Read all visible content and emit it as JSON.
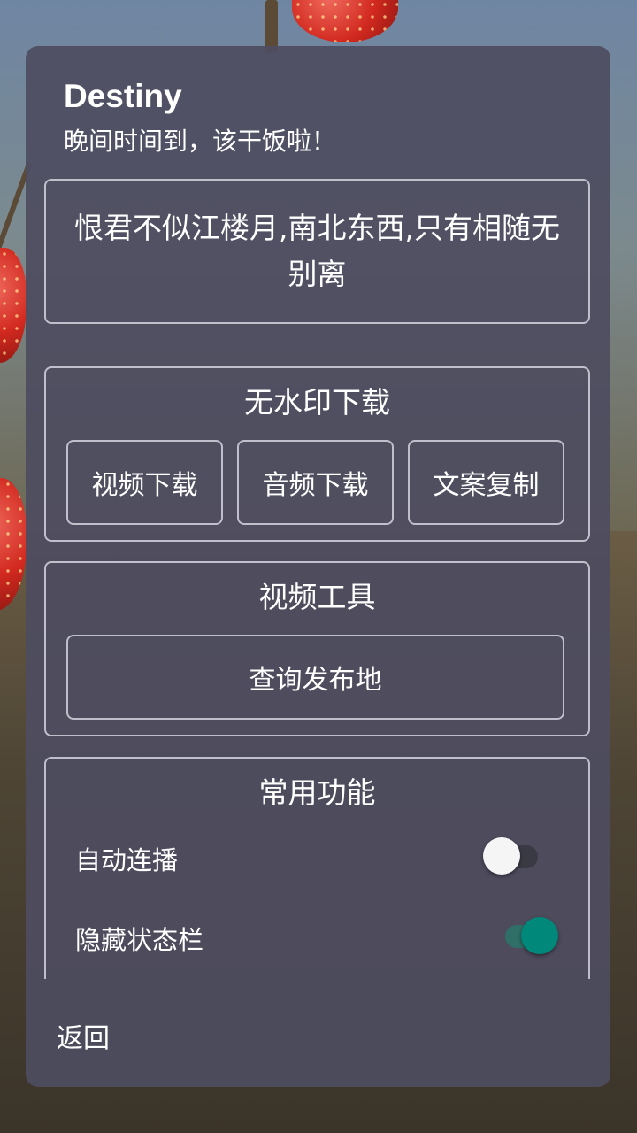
{
  "dialog": {
    "title": "Destiny",
    "subtitle": "晚间时间到，该干饭啦！",
    "poem": "恨君不似江楼月,南北东西,只有相随无别离"
  },
  "download_section": {
    "title": "无水印下载",
    "buttons": [
      "视频下载",
      "音频下载",
      "文案复制"
    ]
  },
  "video_tools_section": {
    "title": "视频工具",
    "query_location_label": "查询发布地"
  },
  "common_section": {
    "title": "常用功能",
    "toggles": [
      {
        "label": "自动连播",
        "state": "off"
      },
      {
        "label": "隐藏状态栏",
        "state": "on"
      }
    ]
  },
  "footer": {
    "back_label": "返回"
  },
  "colors": {
    "dialog_bg": "#4e4c60",
    "switch_on_thumb": "#00897b",
    "switch_on_track": "#2f6f68",
    "switch_off_thumb": "#f5f5f5",
    "switch_off_track": "#3a3a44"
  }
}
